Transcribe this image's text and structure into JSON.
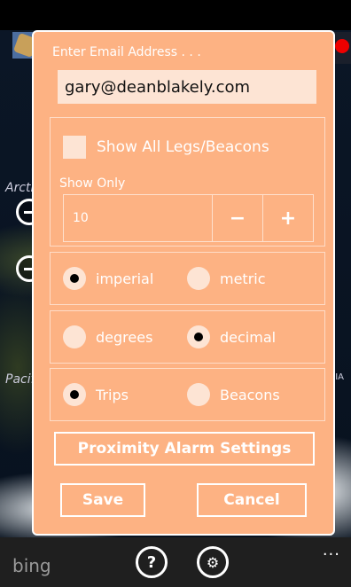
{
  "map": {
    "labels": [
      "Arctic",
      "Pacif",
      "IA"
    ],
    "bing_logo": "bing"
  },
  "dialog": {
    "email_label": "Enter Email Address . . .",
    "email_value": "gary@deanblakely.com",
    "show_all_label": "Show All Legs/Beacons",
    "show_all_checked": false,
    "show_only_label": "Show Only",
    "show_only_value": "10",
    "minus": "−",
    "plus": "+",
    "units": {
      "option1": "imperial",
      "option2": "metric",
      "selected": "imperial"
    },
    "coords": {
      "option1": "degrees",
      "option2": "decimal",
      "selected": "decimal"
    },
    "mode": {
      "option1": "Trips",
      "option2": "Beacons",
      "selected": "Trips"
    },
    "proximity_button": "Proximity Alarm Settings",
    "save_button": "Save",
    "cancel_button": "Cancel"
  },
  "appbar": {
    "help_icon": "?",
    "settings_icon": "⚙",
    "more": "..."
  },
  "colors": {
    "dialog_bg": "#fdb283",
    "field_bg": "#fde4d4",
    "appbar_bg": "#1f1f1f"
  }
}
